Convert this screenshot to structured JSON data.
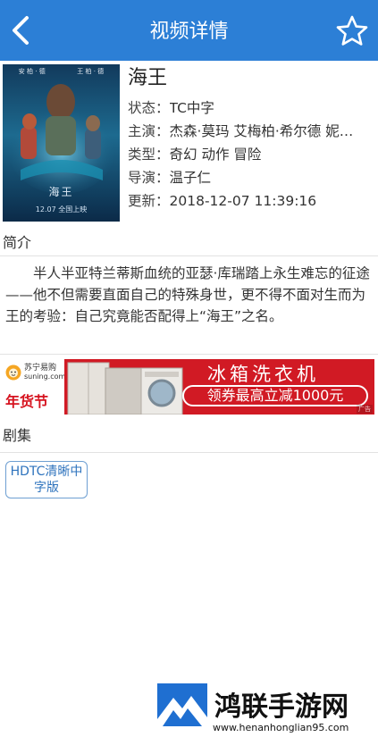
{
  "header": {
    "title": "视频详情",
    "back_icon": "chevron-left-icon",
    "favorite_icon": "star-outline-icon",
    "bg_color": "#2c7fd6"
  },
  "poster": {
    "cast_top_left": "安 柏 · 德",
    "cast_top_right": "王 柏 · 德",
    "name": "海王",
    "date_text": "12.07 全国上映"
  },
  "movie": {
    "title": "海王",
    "status_label": "状态：",
    "status": "TC中字",
    "cast_label": "主演：",
    "cast": "杰森·莫玛 艾梅柏·希尔德 妮…",
    "genre_label": "类型：",
    "genre": "奇幻 动作 冒险",
    "director_label": "导演：",
    "director": "温子仁",
    "updated_label": "更新：",
    "updated": "2018-12-07 11:39:16"
  },
  "synopsis": {
    "heading": "简介",
    "text": "半人半亚特兰蒂斯血统的亚瑟·库瑞踏上永生难忘的征途——他不但需要直面自己的特殊身世，更不得不面对生而为王的考验：自己究竟能否配得上“海王”之名。"
  },
  "ad": {
    "brand_cn": "苏宁易购",
    "brand_url": "suning.com",
    "festival": "年货节",
    "headline": "冰箱洗衣机",
    "coupon": "领券最高立减1000元",
    "ad_mark": "广告",
    "accent_color": "#d11a24"
  },
  "episodes": {
    "heading": "剧集",
    "items": [
      "HDTC清晰中字版"
    ]
  },
  "watermark": {
    "name": "鸿联手游网",
    "url": "www.henanhonglian95.com"
  }
}
